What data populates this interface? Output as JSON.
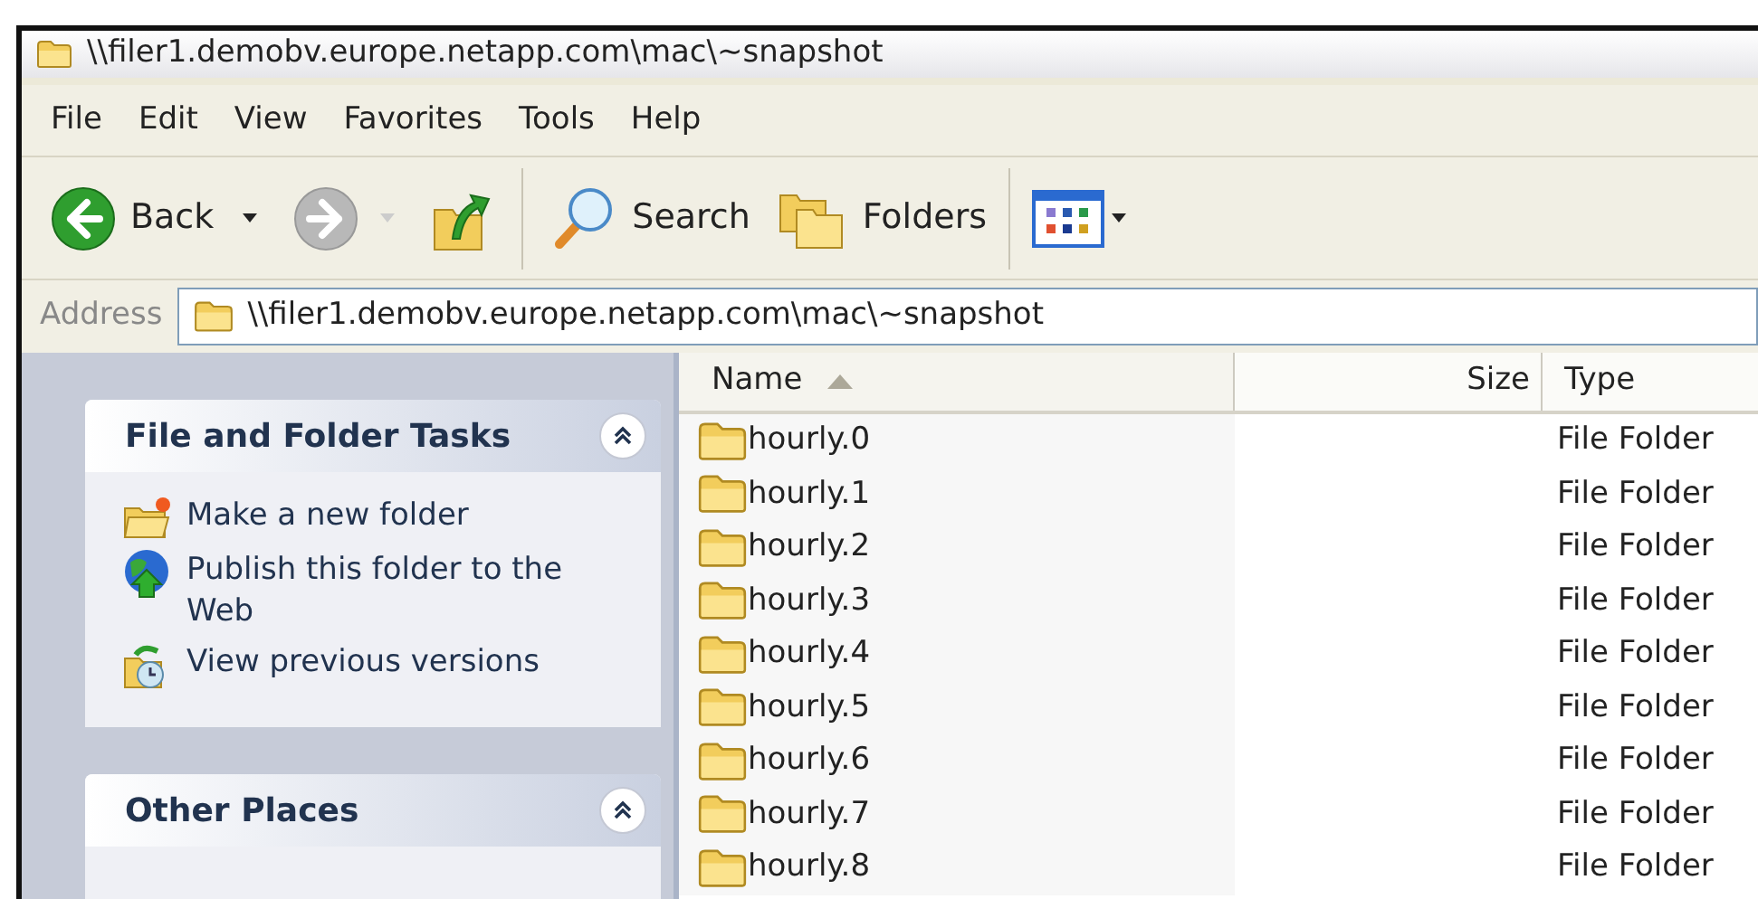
{
  "window": {
    "title": "\\\\filer1.demobv.europe.netapp.com\\mac\\~snapshot"
  },
  "menu": [
    "File",
    "Edit",
    "View",
    "Favorites",
    "Tools",
    "Help"
  ],
  "toolbar": [
    {
      "kind": "back",
      "label": "Back",
      "disabled": false
    },
    {
      "kind": "forward",
      "disabled": true
    },
    {
      "kind": "up"
    },
    {
      "kind": "separator"
    },
    {
      "kind": "search",
      "label": "Search"
    },
    {
      "kind": "folders",
      "label": "Folders"
    },
    {
      "kind": "separator"
    },
    {
      "kind": "views"
    }
  ],
  "address": {
    "label": "Address",
    "value": "\\\\filer1.demobv.europe.netapp.com\\mac\\~snapshot"
  },
  "panels": [
    {
      "title": "File and Folder Tasks",
      "expanded": true,
      "items": [
        {
          "kind": "new-folder",
          "label": "Make a new folder"
        },
        {
          "kind": "publish",
          "label": "Publish this folder to the Web"
        },
        {
          "kind": "versions",
          "label": "View previous versions"
        }
      ]
    },
    {
      "title": "Other Places",
      "expanded": true
    }
  ],
  "table": {
    "columns": [
      {
        "label": "Name",
        "sorted": true
      },
      {
        "label": "Size",
        "sorted": false
      },
      {
        "label": "Type",
        "sorted": false
      }
    ],
    "rows": [
      {
        "name": "hourly.0",
        "type": "File Folder"
      },
      {
        "name": "hourly.1",
        "type": "File Folder"
      },
      {
        "name": "hourly.2",
        "type": "File Folder"
      },
      {
        "name": "hourly.3",
        "type": "File Folder"
      },
      {
        "name": "hourly.4",
        "type": "File Folder"
      },
      {
        "name": "hourly.5",
        "type": "File Folder"
      },
      {
        "name": "hourly.6",
        "type": "File Folder"
      },
      {
        "name": "hourly.7",
        "type": "File Folder"
      },
      {
        "name": "hourly.8",
        "type": "File Folder"
      }
    ]
  }
}
